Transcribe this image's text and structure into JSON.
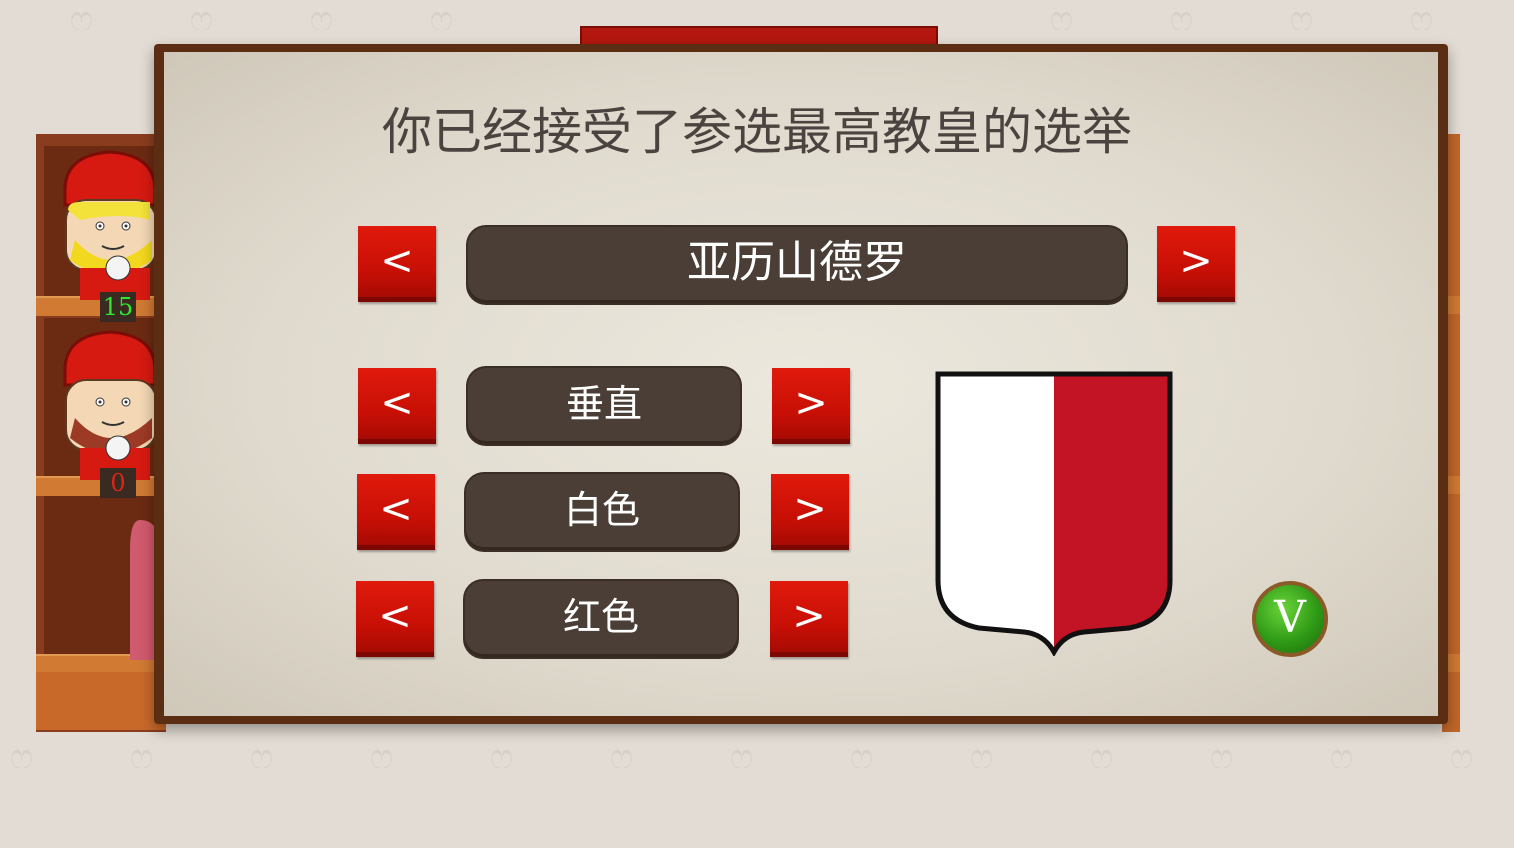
{
  "dialog": {
    "title": "你已经接受了参选最高教皇的选举",
    "name": {
      "value": "亚历山德罗",
      "prev_label": "<",
      "next_label": ">"
    },
    "options": [
      {
        "value": "垂直",
        "prev_label": "<",
        "next_label": ">"
      },
      {
        "value": "白色",
        "prev_label": "<",
        "next_label": ">"
      },
      {
        "value": "红色",
        "prev_label": "<",
        "next_label": ">"
      }
    ],
    "confirm_label": "V",
    "shield": {
      "division": "vertical",
      "left_color": "#ffffff",
      "right_color": "#c21424"
    }
  },
  "cardinals": [
    {
      "votes": "15",
      "beard": "blonde"
    },
    {
      "votes": "0",
      "beard": "brown"
    }
  ],
  "colors": {
    "button_red": "#c70f05",
    "pill_brown": "#4a3e36",
    "confirm_green": "#2f9a16"
  }
}
